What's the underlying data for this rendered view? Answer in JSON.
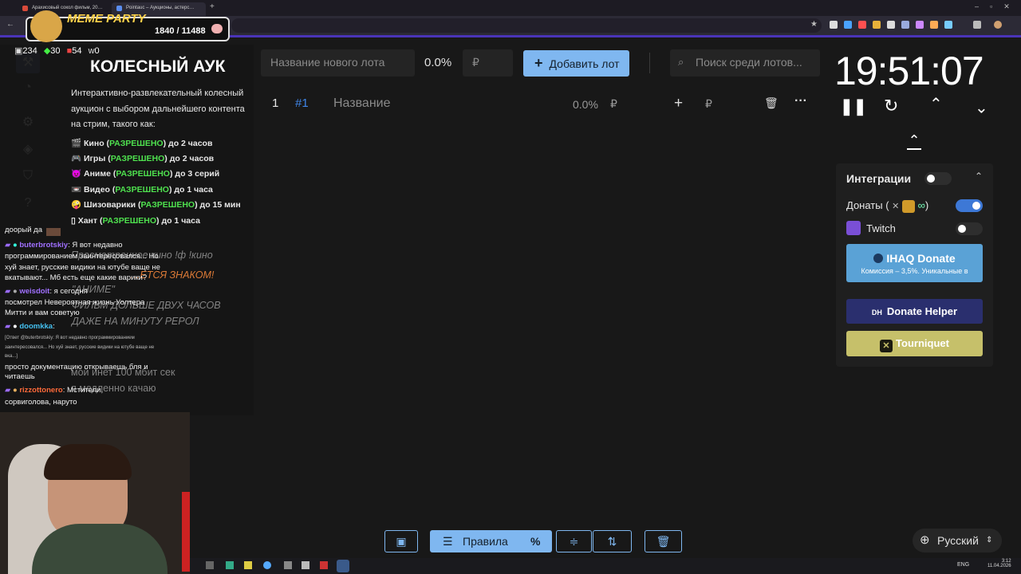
{
  "browser": {
    "tabs": [
      {
        "label": "Арахисовый сокол фильм, 20…"
      },
      {
        "label": "Pointauc – Аукционы, астерс…"
      }
    ]
  },
  "overlay_badge": {
    "title": "MEME PARTY",
    "count": "1840 / 11488"
  },
  "stats": {
    "viewers": "234",
    "followers": "30",
    "subs": "54",
    "w": "0"
  },
  "rules_panel": {
    "title": "КОЛЕСНЫЙ АУК",
    "intro": [
      "Интерактивно-развлекательный колесный",
      "аукцион с выбором дальнейшего контента",
      "на стрим, такого как:"
    ],
    "allowed": "РАЗРЕШЕНО",
    "items": [
      {
        "icon": "🎬",
        "name": "Кино",
        "limit": "до 2 часов"
      },
      {
        "icon": "🎮",
        "name": "Игры",
        "limit": "до 2 часов"
      },
      {
        "icon": "😈",
        "name": "Аниме",
        "limit": "до 3 серий"
      },
      {
        "icon": "📼",
        "name": "Видео",
        "limit": "до 1 часа"
      },
      {
        "icon": "🤪",
        "name": "Шизоварики",
        "limit": "до 15 мин"
      },
      {
        "icon": "▯",
        "name": "Хант",
        "limit": "до 1 часа"
      }
    ]
  },
  "ghost_text": [
    "Просмотренное кино !ф !кино",
    "…ЕТСЯ ЗНАКОМ!",
    "\"АНИМЕ\"",
    "ФИЛЬМ ДОЛЬШЕ ДВУХ ЧАСОВ",
    "ДАЖЕ НА МИНУТУ РЕРОЛ",
    "мой инет 100 мбит сек",
    "я медленно качаю"
  ],
  "chat": {
    "top": "доорый да",
    "messages": [
      {
        "user": "buterbrotskiy",
        "user_color": "#a070ff",
        "lines": [
          "Я вот недавно",
          "программированием заинтересовался... Но",
          "хуй знает, русские видики на ютубе ваще не",
          "вкатывают... Мб есть еще какие варики?"
        ]
      },
      {
        "user": "weisdoit",
        "user_color": "#a070ff",
        "lines": [
          "я сегодня",
          "посмотрел Невероятная жизнь Уолтера",
          "Митти и вам советую"
        ]
      },
      {
        "user": "doomkka",
        "user_color": "#44c0f0",
        "reply": [
          "[Ответ @buterbrotskiy: Я вот недавно программированием",
          "заинтересовался... Но хуй знает, русские видики на ютубе ваще не",
          "вка...]"
        ],
        "lines": [
          "просто документацию открываешь бля и",
          "читаешь"
        ]
      },
      {
        "user": "rizzottonero",
        "user_color": "#ff6a3a",
        "lines": [
          "Мстители,",
          "сорвиголова, наруто"
        ]
      }
    ]
  },
  "top_bar": {
    "new_lot_placeholder": "Название нового лота",
    "percent": "0.0%",
    "currency": "₽",
    "add_button": "Добавить лот",
    "search_placeholder": "Поиск среди лотов..."
  },
  "lots": [
    {
      "index": "1",
      "id": "#1",
      "name": "Название",
      "percent": "0.0%",
      "currency": "₽",
      "plus": "+",
      "add_currency": "₽"
    }
  ],
  "timer": "19:51:07",
  "integrations": {
    "title": "Интеграции",
    "donations_label": "Донаты (",
    "donations_close": ")",
    "twitch_label": "Twitch",
    "ihaq": {
      "title": "IHAQ Donate",
      "subtitle": "Комиссия – 3,5%. Уникальные в"
    },
    "donate_helper": "Donate Helper",
    "tourniquet": "Tourniquet"
  },
  "bottom_toolbar": {
    "rules_label": "Правила",
    "percent_icon": "%"
  },
  "language": "Русский",
  "taskbar": {
    "lang": "ENG",
    "time": "3:12",
    "date": "11.04.2026"
  },
  "colors": {
    "accent": "#7fb7f0",
    "app_bg": "#181818",
    "panel_bg": "#1f1f1f",
    "ihaq": "#5aa2d6",
    "donate_helper": "#2a2f6e",
    "tourniquet": "#c6c06a",
    "allowed": "#4ee04e"
  }
}
